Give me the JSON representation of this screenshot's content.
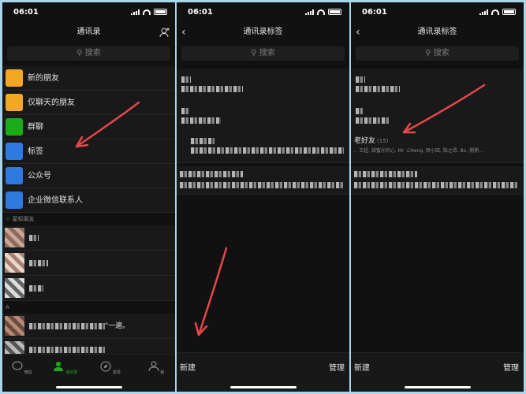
{
  "status": {
    "time": "06:01"
  },
  "contacts": {
    "title": "通讯录",
    "search_placeholder": "搜索",
    "menu": [
      {
        "label": "新的朋友",
        "icon": "add-friend-icon",
        "color": "#f5a623"
      },
      {
        "label": "仅聊天的朋友",
        "icon": "chat-only-icon",
        "color": "#f5a623"
      },
      {
        "label": "群聊",
        "icon": "group-chat-icon",
        "color": "#1aad19"
      },
      {
        "label": "标签",
        "icon": "tag-icon",
        "color": "#2e7ae0"
      },
      {
        "label": "公众号",
        "icon": "official-account-icon",
        "color": "#2e7ae0"
      },
      {
        "label": "企业微信联系人",
        "icon": "work-contact-icon",
        "color": "#2e7ae0"
      }
    ],
    "starred_header": "星标朋友",
    "section_a": "A",
    "contact_snippet": "\"一遍。",
    "tabs": [
      {
        "label": "微信",
        "icon": "chat-icon"
      },
      {
        "label": "通讯录",
        "icon": "contacts-icon"
      },
      {
        "label": "发现",
        "icon": "discover-icon"
      },
      {
        "label": "我",
        "icon": "me-icon"
      }
    ],
    "accent": "#1aad19"
  },
  "tags_screen": {
    "title": "通讯录标签",
    "search_placeholder": "搜索",
    "new_label": "新建",
    "manage_label": "管理"
  },
  "tags_screen_2": {
    "title": "通讯录标签",
    "search_placeholder": "搜索",
    "tag_name": "老好友",
    "tag_count": "(15)",
    "tag_members": "、王超, 甜蜜＠的心, Mr .CHeng, 颜小田, 陆之昂, Bo, 粥粥...",
    "new_label": "新建",
    "manage_label": "管理"
  },
  "annotation_color": "#e8474a"
}
